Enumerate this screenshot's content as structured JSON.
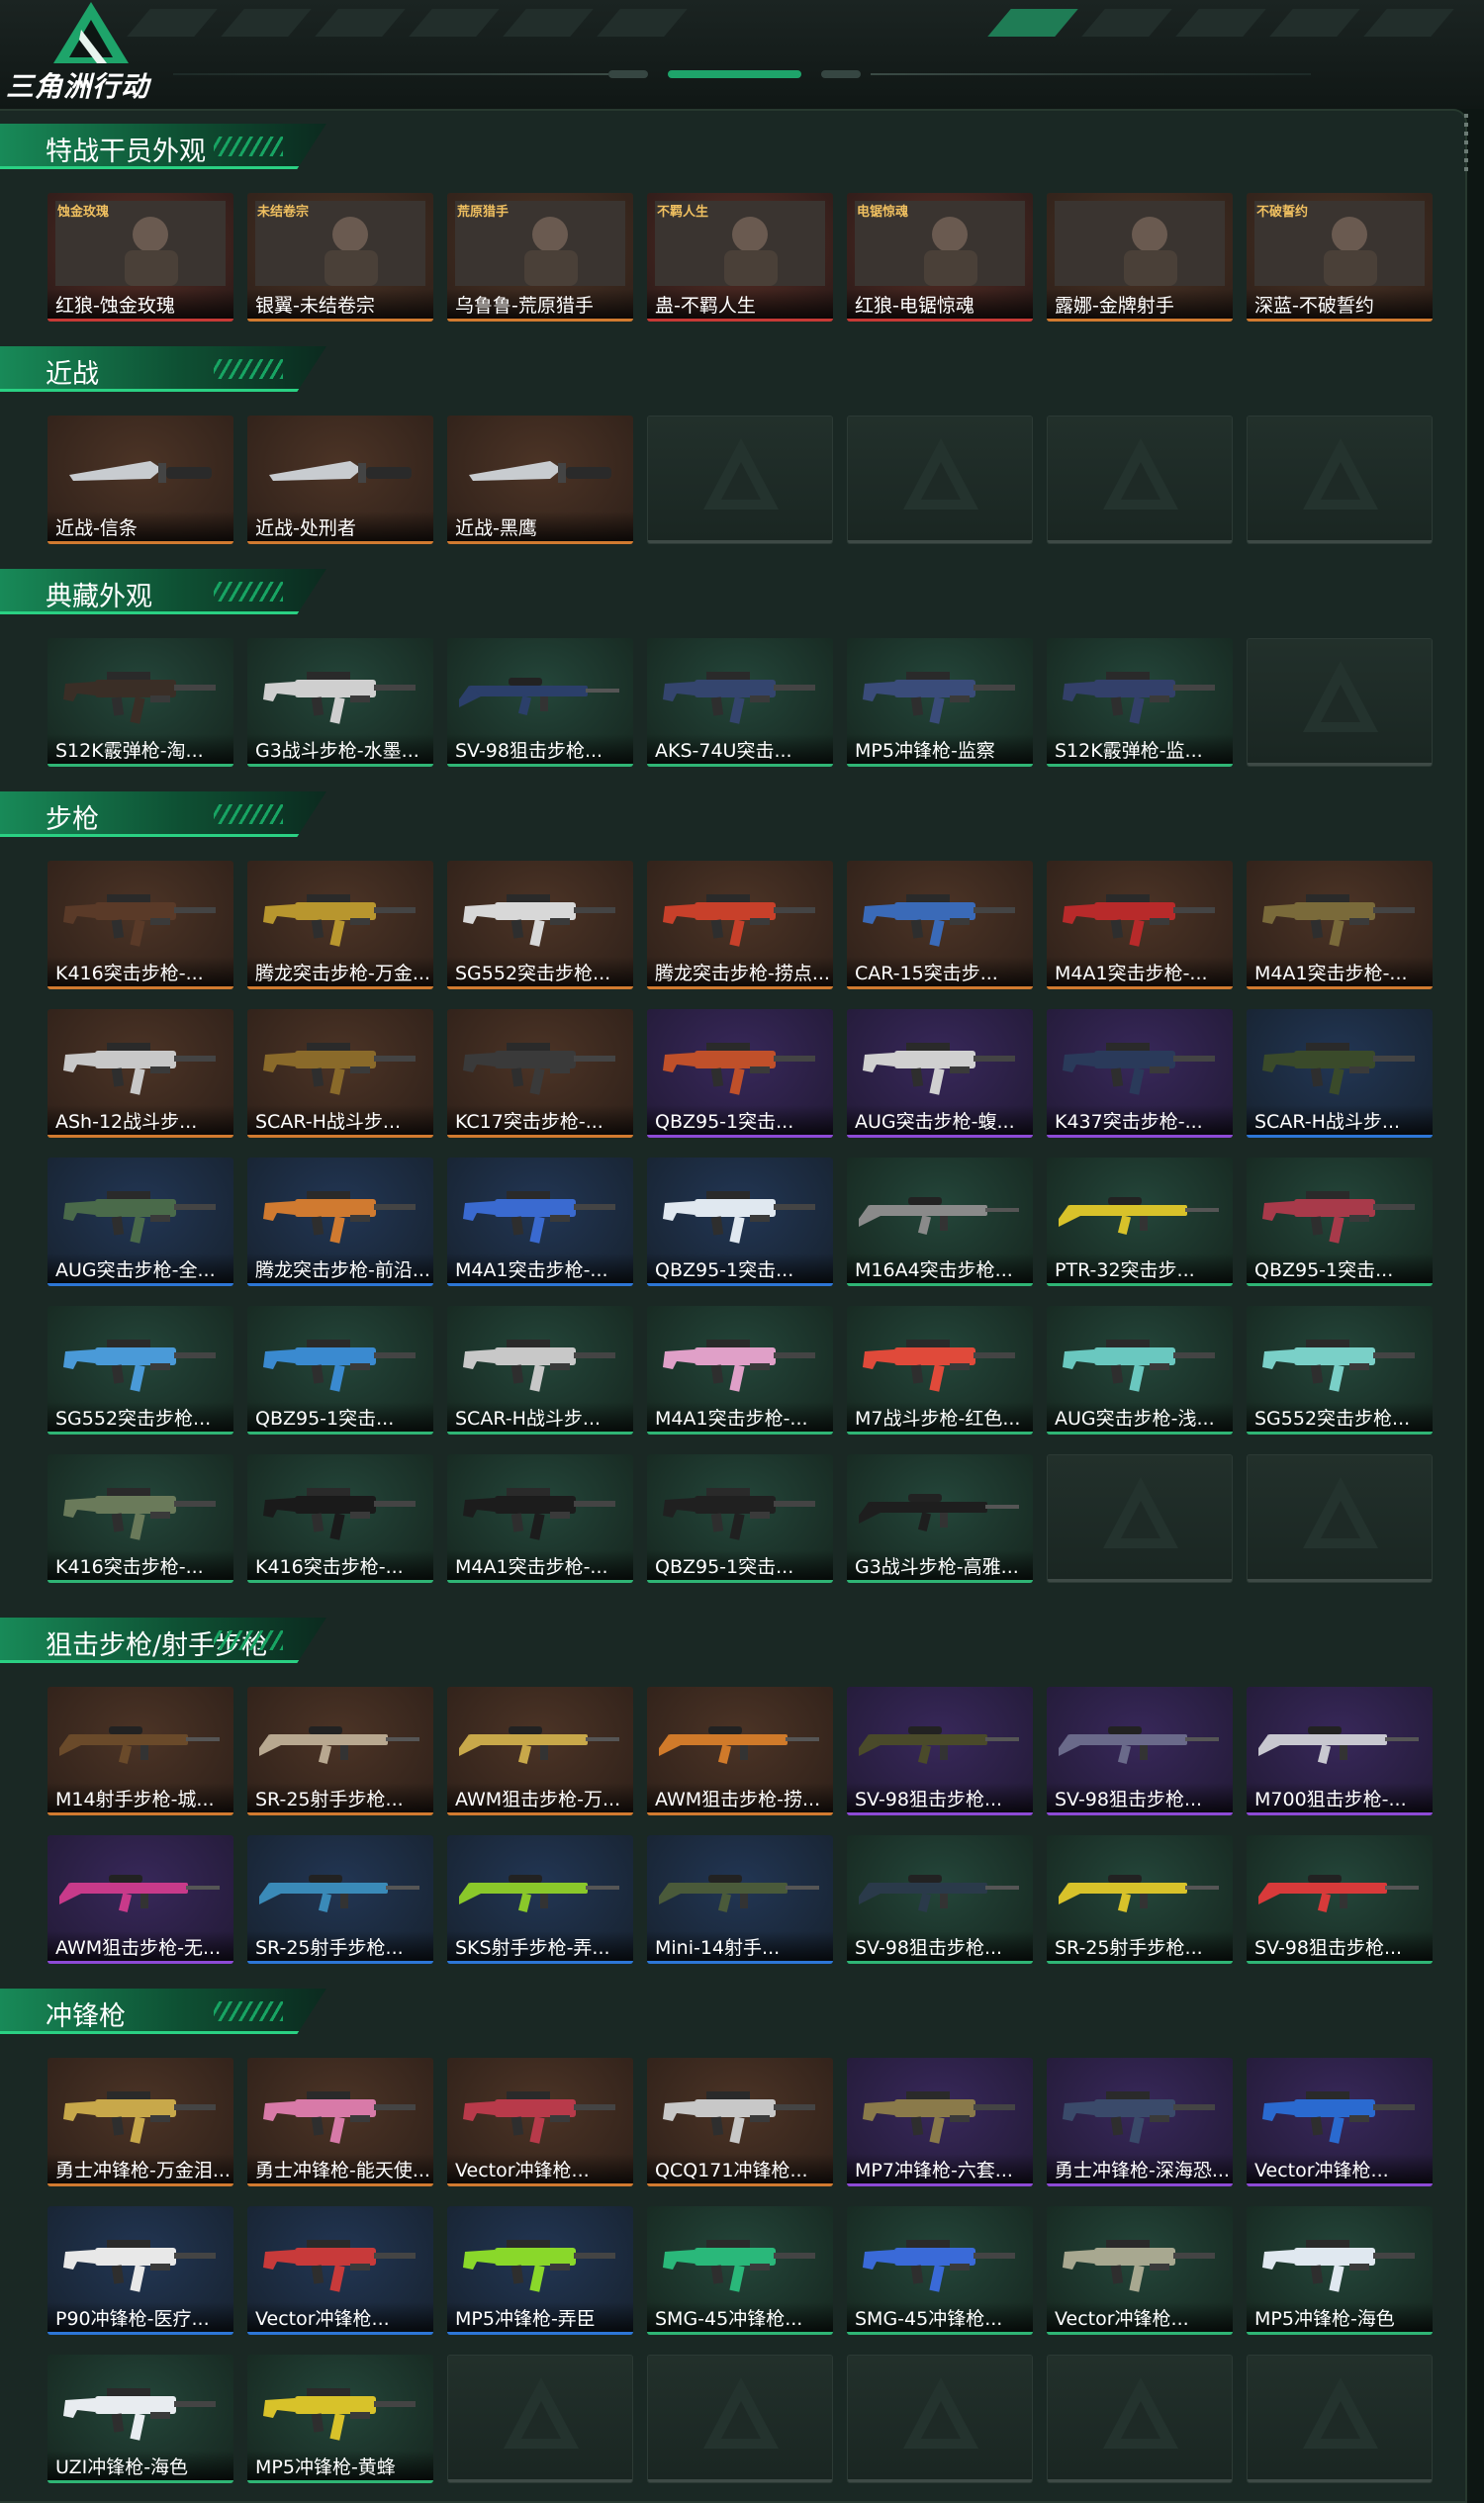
{
  "app": {
    "logo_text": "三角洲行动",
    "accent": "#1ea46a"
  },
  "sections": [
    {
      "title": "特战干员外观",
      "items": [
        {
          "label": "红狼-蚀金玫瑰",
          "rarity": "red",
          "kind": "operator",
          "logo_text": "蚀金玫瑰"
        },
        {
          "label": "银翼-未结卷宗",
          "rarity": "orange",
          "kind": "operator",
          "logo_text": "未结卷宗"
        },
        {
          "label": "乌鲁鲁-荒原猎手",
          "rarity": "orange",
          "kind": "operator",
          "logo_text": "荒原猎手"
        },
        {
          "label": "蛊-不羁人生",
          "rarity": "red",
          "kind": "operator",
          "logo_text": "不羁人生"
        },
        {
          "label": "红狼-电锯惊魂",
          "rarity": "red",
          "kind": "operator",
          "logo_text": "电锯惊魂"
        },
        {
          "label": "露娜-金牌射手",
          "rarity": "orange",
          "kind": "operator",
          "logo_text": ""
        },
        {
          "label": "深蓝-不破誓约",
          "rarity": "orange",
          "kind": "operator",
          "logo_text": "不破誓约"
        }
      ]
    },
    {
      "title": "近战",
      "items": [
        {
          "label": "近战-信条",
          "rarity": "orange",
          "kind": "knife"
        },
        {
          "label": "近战-处刑者",
          "rarity": "orange",
          "kind": "knife"
        },
        {
          "label": "近战-黑鹰",
          "rarity": "orange",
          "kind": "knife"
        },
        {
          "label": "",
          "rarity": "empty",
          "kind": "empty"
        },
        {
          "label": "",
          "rarity": "empty",
          "kind": "empty"
        },
        {
          "label": "",
          "rarity": "empty",
          "kind": "empty"
        },
        {
          "label": "",
          "rarity": "empty",
          "kind": "empty"
        }
      ]
    },
    {
      "title": "典藏外观",
      "items": [
        {
          "label": "S12K霰弹枪-淘...",
          "rarity": "green",
          "kind": "gun",
          "color": "#3a2e26"
        },
        {
          "label": "G3战斗步枪-水墨...",
          "rarity": "green",
          "kind": "gun",
          "color": "#cfcfcf"
        },
        {
          "label": "SV-98狙击步枪...",
          "rarity": "green",
          "kind": "rifle",
          "color": "#2b3f6a"
        },
        {
          "label": "AKS-74U突击...",
          "rarity": "green",
          "kind": "gun",
          "color": "#34456e"
        },
        {
          "label": "MP5冲锋枪-监察",
          "rarity": "green",
          "kind": "gun",
          "color": "#3a4c7a"
        },
        {
          "label": "S12K霰弹枪-监...",
          "rarity": "green",
          "kind": "gun",
          "color": "#33406a"
        },
        {
          "label": "",
          "rarity": "empty",
          "kind": "empty"
        }
      ]
    },
    {
      "title": "步枪",
      "items": [
        {
          "label": "K416突击步枪-...",
          "rarity": "orange",
          "kind": "gun",
          "color": "#5a3a28"
        },
        {
          "label": "腾龙突击步枪-万金...",
          "rarity": "orange",
          "kind": "gun",
          "color": "#b8962e"
        },
        {
          "label": "SG552突击步枪...",
          "rarity": "orange",
          "kind": "gun",
          "color": "#d8d8d8"
        },
        {
          "label": "腾龙突击步枪-捞点...",
          "rarity": "orange",
          "kind": "gun",
          "color": "#c8402a"
        },
        {
          "label": "CAR-15突击步...",
          "rarity": "orange",
          "kind": "gun",
          "color": "#3a6ab8"
        },
        {
          "label": "M4A1突击步枪-...",
          "rarity": "orange",
          "kind": "gun",
          "color": "#b82a2a"
        },
        {
          "label": "M4A1突击步枪-...",
          "rarity": "orange",
          "kind": "gun",
          "color": "#7a6a3a"
        },
        {
          "label": "ASh-12战斗步...",
          "rarity": "orange",
          "kind": "gun",
          "color": "#c8c8c8"
        },
        {
          "label": "SCAR-H战斗步...",
          "rarity": "orange",
          "kind": "gun",
          "color": "#8a6a2a"
        },
        {
          "label": "KC17突击步枪-...",
          "rarity": "orange",
          "kind": "gun",
          "color": "#3a3a3a"
        },
        {
          "label": "QBZ95-1突击...",
          "rarity": "purple",
          "kind": "gun",
          "color": "#c0502a"
        },
        {
          "label": "AUG突击步枪-蝮...",
          "rarity": "purple",
          "kind": "gun",
          "color": "#d0d0d0"
        },
        {
          "label": "K437突击步枪-...",
          "rarity": "purple",
          "kind": "gun",
          "color": "#2a3a5a"
        },
        {
          "label": "SCAR-H战斗步...",
          "rarity": "blue",
          "kind": "gun",
          "color": "#3a4a2a"
        },
        {
          "label": "AUG突击步枪-全...",
          "rarity": "blue",
          "kind": "gun",
          "color": "#4a6a4a"
        },
        {
          "label": "腾龙突击步枪-前沿...",
          "rarity": "blue",
          "kind": "gun",
          "color": "#d07a30"
        },
        {
          "label": "M4A1突击步枪-...",
          "rarity": "blue",
          "kind": "gun",
          "color": "#3a6ad0"
        },
        {
          "label": "QBZ95-1突击...",
          "rarity": "blue",
          "kind": "gun",
          "color": "#e0e8f0"
        },
        {
          "label": "M16A4突击步枪...",
          "rarity": "green",
          "kind": "rifle",
          "color": "#8a8a8a"
        },
        {
          "label": "PTR-32突击步...",
          "rarity": "green",
          "kind": "rifle",
          "color": "#d8c22a"
        },
        {
          "label": "QBZ95-1突击...",
          "rarity": "green",
          "kind": "gun",
          "color": "#a83a4a"
        },
        {
          "label": "SG552突击步枪...",
          "rarity": "green",
          "kind": "gun",
          "color": "#4a9ad8"
        },
        {
          "label": "QBZ95-1突击...",
          "rarity": "green",
          "kind": "gun",
          "color": "#3a8ad0"
        },
        {
          "label": "SCAR-H战斗步...",
          "rarity": "green",
          "kind": "gun",
          "color": "#c8c8c8"
        },
        {
          "label": "M4A1突击步枪-...",
          "rarity": "green",
          "kind": "gun",
          "color": "#e0a0c8"
        },
        {
          "label": "M7战斗步枪-红色...",
          "rarity": "green",
          "kind": "gun",
          "color": "#e04a3a"
        },
        {
          "label": "AUG突击步枪-浅...",
          "rarity": "green",
          "kind": "gun",
          "color": "#6ac8c0"
        },
        {
          "label": "SG552突击步枪...",
          "rarity": "green",
          "kind": "gun",
          "color": "#7ad0c8"
        },
        {
          "label": "K416突击步枪-...",
          "rarity": "green",
          "kind": "gun",
          "color": "#6a7a5a"
        },
        {
          "label": "K416突击步枪-...",
          "rarity": "green",
          "kind": "gun",
          "color": "#1a1a1a"
        },
        {
          "label": "M4A1突击步枪-...",
          "rarity": "green",
          "kind": "gun",
          "color": "#1c1c1c"
        },
        {
          "label": "QBZ95-1突击...",
          "rarity": "green",
          "kind": "gun",
          "color": "#202020"
        },
        {
          "label": "G3战斗步枪-高雅...",
          "rarity": "green",
          "kind": "rifle",
          "color": "#1e1e1e"
        },
        {
          "label": "",
          "rarity": "empty",
          "kind": "empty"
        },
        {
          "label": "",
          "rarity": "empty",
          "kind": "empty"
        }
      ]
    },
    {
      "title": "狙击步枪/射手步枪",
      "items": [
        {
          "label": "M14射手步枪-城...",
          "rarity": "orange",
          "kind": "rifle",
          "color": "#6a4a2a"
        },
        {
          "label": "SR-25射手步枪...",
          "rarity": "orange",
          "kind": "rifle",
          "color": "#b8a890"
        },
        {
          "label": "AWM狙击步枪-万...",
          "rarity": "orange",
          "kind": "rifle",
          "color": "#c8a84a"
        },
        {
          "label": "AWM狙击步枪-捞...",
          "rarity": "orange",
          "kind": "rifle",
          "color": "#d07a2a"
        },
        {
          "label": "SV-98狙击步枪...",
          "rarity": "purple",
          "kind": "rifle",
          "color": "#4a4a2a"
        },
        {
          "label": "SV-98狙击步枪...",
          "rarity": "purple",
          "kind": "rifle",
          "color": "#6a6a8a"
        },
        {
          "label": "M700狙击步枪-...",
          "rarity": "purple",
          "kind": "rifle",
          "color": "#c8c8d0"
        },
        {
          "label": "AWM狙击步枪-无...",
          "rarity": "purple",
          "kind": "rifle",
          "color": "#c83a8a"
        },
        {
          "label": "SR-25射手步枪...",
          "rarity": "blue",
          "kind": "rifle",
          "color": "#3a8ab8"
        },
        {
          "label": "SKS射手步枪-弄...",
          "rarity": "blue",
          "kind": "rifle",
          "color": "#8ac82a"
        },
        {
          "label": "Mini-14射手...",
          "rarity": "blue",
          "kind": "rifle",
          "color": "#4a5a3a"
        },
        {
          "label": "SV-98狙击步枪...",
          "rarity": "green",
          "kind": "rifle",
          "color": "#2a3a4a"
        },
        {
          "label": "SR-25射手步枪...",
          "rarity": "green",
          "kind": "rifle",
          "color": "#d8c22a"
        },
        {
          "label": "SV-98狙击步枪...",
          "rarity": "green",
          "kind": "rifle",
          "color": "#d83a3a"
        }
      ]
    },
    {
      "title": "冲锋枪",
      "items": [
        {
          "label": "勇士冲锋枪-万金泪...",
          "rarity": "orange",
          "kind": "gun",
          "color": "#c8a84a"
        },
        {
          "label": "勇士冲锋枪-能天使...",
          "rarity": "orange",
          "kind": "gun",
          "color": "#d87aa8"
        },
        {
          "label": "Vector冲锋枪...",
          "rarity": "orange",
          "kind": "gun",
          "color": "#b83a4a"
        },
        {
          "label": "QCQ171冲锋枪...",
          "rarity": "orange",
          "kind": "gun",
          "color": "#c8c8c8"
        },
        {
          "label": "MP7冲锋枪-六套...",
          "rarity": "purple",
          "kind": "gun",
          "color": "#8a7a4a"
        },
        {
          "label": "勇士冲锋枪-深海恐...",
          "rarity": "purple",
          "kind": "gun",
          "color": "#3a4a6a"
        },
        {
          "label": "Vector冲锋枪...",
          "rarity": "purple",
          "kind": "gun",
          "color": "#2a6ad0"
        },
        {
          "label": "P90冲锋枪-医疗...",
          "rarity": "blue",
          "kind": "gun",
          "color": "#e8e8e8"
        },
        {
          "label": "Vector冲锋枪...",
          "rarity": "blue",
          "kind": "gun",
          "color": "#c83a3a"
        },
        {
          "label": "MP5冲锋枪-弄臣",
          "rarity": "blue",
          "kind": "gun",
          "color": "#8ad82a"
        },
        {
          "label": "SMG-45冲锋枪...",
          "rarity": "green",
          "kind": "gun",
          "color": "#2ab87a"
        },
        {
          "label": "SMG-45冲锋枪...",
          "rarity": "green",
          "kind": "gun",
          "color": "#3a6ad8"
        },
        {
          "label": "Vector冲锋枪...",
          "rarity": "green",
          "kind": "gun",
          "color": "#a8a890"
        },
        {
          "label": "MP5冲锋枪-海色",
          "rarity": "green",
          "kind": "gun",
          "color": "#e0e8f0"
        },
        {
          "label": "UZI冲锋枪-海色",
          "rarity": "green",
          "kind": "gun",
          "color": "#e8ecf0"
        },
        {
          "label": "MP5冲锋枪-黄蜂",
          "rarity": "green",
          "kind": "gun",
          "color": "#d8c22a"
        },
        {
          "label": "",
          "rarity": "empty",
          "kind": "empty"
        },
        {
          "label": "",
          "rarity": "empty",
          "kind": "empty"
        },
        {
          "label": "",
          "rarity": "empty",
          "kind": "empty"
        },
        {
          "label": "",
          "rarity": "empty",
          "kind": "empty"
        },
        {
          "label": "",
          "rarity": "empty",
          "kind": "empty"
        }
      ]
    }
  ]
}
